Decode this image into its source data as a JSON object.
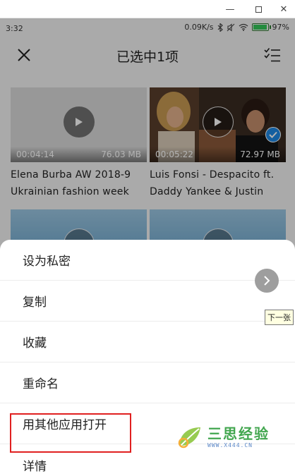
{
  "window": {
    "minimize_glyph": "—",
    "close_glyph": "✕"
  },
  "status_bar": {
    "time": "3:32",
    "network_speed": "0.09K/s",
    "battery_percent": "97%",
    "battery_level": 0.97,
    "icons": [
      "bluetooth-icon",
      "mute-icon",
      "wifi-icon",
      "battery-icon"
    ]
  },
  "app_bar": {
    "title": "已选中1项",
    "close_icon": "close-icon",
    "select_icon": "checklist-icon"
  },
  "videos": [
    {
      "duration": "00:04:14",
      "size": "76.03 MB",
      "title": "Elena Burba AW 2018-9",
      "subtitle": "Ukrainian fashion week",
      "selected": false
    },
    {
      "duration": "00:05:22",
      "size": "72.97 MB",
      "title": "Luis Fonsi - Despacito ft.",
      "subtitle": "Daddy Yankee & Justin",
      "selected": true
    },
    {
      "duration": "",
      "size": "",
      "title": "",
      "subtitle": "",
      "selected": false
    },
    {
      "duration": "",
      "size": "",
      "title": "",
      "subtitle": "",
      "selected": false
    }
  ],
  "sheet": {
    "items": [
      {
        "label": "设为私密"
      },
      {
        "label": "复制"
      },
      {
        "label": "收藏"
      },
      {
        "label": "重命名"
      },
      {
        "label": "用其他应用打开"
      },
      {
        "label": "详情"
      }
    ],
    "highlighted_index": 4
  },
  "next_button": {
    "tooltip": "下一张"
  },
  "watermark": {
    "brand": "三思经验",
    "url": "WWW.X444.CN"
  },
  "colors": {
    "accent": "#1e88e5",
    "highlight": "#e02020",
    "watermark": "#2e9d3c"
  }
}
